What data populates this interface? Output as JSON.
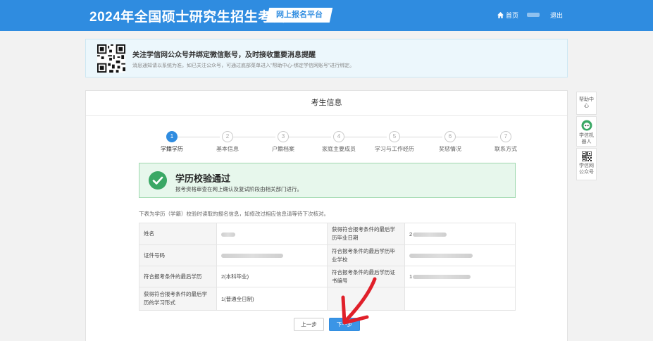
{
  "header": {
    "title": "2024年全国硕士研究生招生考试",
    "platform": "网上报名平台",
    "home": "首页",
    "logout": "退出"
  },
  "notice": {
    "title": "关注学信网公众号并绑定微信账号，及时接收重要消息提醒",
    "desc": "消息通知请以系统为准。如已关注公众号，可通过底部菜单进入\"帮助中心-绑定学信网账号\"进行绑定。"
  },
  "panel": {
    "title": "考生信息",
    "steps": [
      {
        "num": "1",
        "label": "学籍学历"
      },
      {
        "num": "2",
        "label": "基本信息"
      },
      {
        "num": "3",
        "label": "户籍档案"
      },
      {
        "num": "4",
        "label": "家庭主要成员"
      },
      {
        "num": "5",
        "label": "学习与工作经历"
      },
      {
        "num": "6",
        "label": "奖惩情况"
      },
      {
        "num": "7",
        "label": "联系方式"
      }
    ],
    "active_step": 1,
    "success": {
      "title": "学历校验通过",
      "desc": "报考资格审查在网上确认及复试阶段由相关部门进行。"
    },
    "hint": "下表为学历（学籍）校验时读取的报名信息，如修改过相应信息请等待下次核对。",
    "table": {
      "name_label": "姓名",
      "id_label": "证件号码",
      "degree_label": "符合报考条件的最后学历",
      "degree_value": "2(本科毕业)",
      "study_form_label": "获得符合报考条件的最后学历的学习形式",
      "study_form_value": "1(普通全日制)",
      "grad_date_label": "获得符合报考条件的最后学历毕业日期",
      "grad_date_value": "2",
      "school_label": "符合报考条件的最后学历毕业学校",
      "cert_label": "符合报考条件的最后学历证书编号",
      "cert_value": "1"
    },
    "prev_button": "上一步",
    "next_button": "下一步"
  },
  "sidebar": {
    "help": "帮助中心",
    "robot": "学信机器人",
    "wechat": "学信网公众号"
  },
  "colors": {
    "primary": "#2f8ce0",
    "success": "#3aa865",
    "annotation_arrow": "#e0202a"
  }
}
